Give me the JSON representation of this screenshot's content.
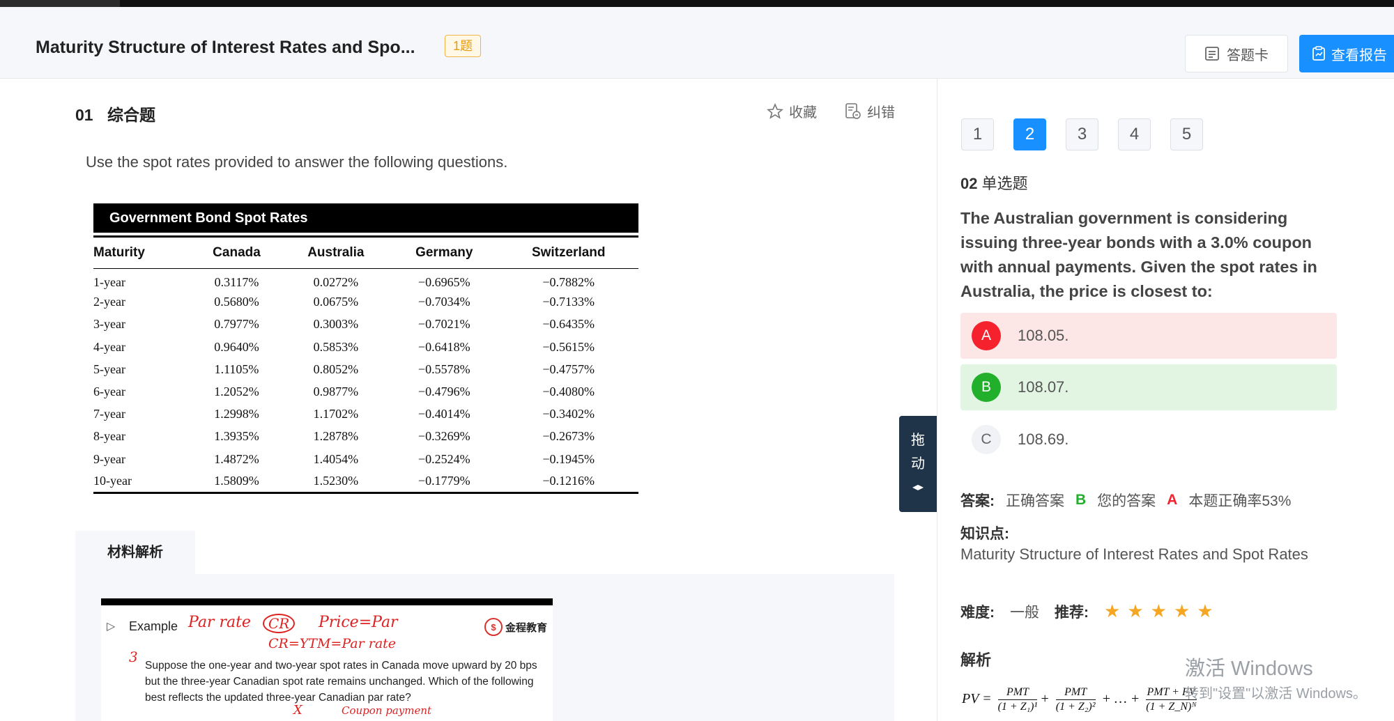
{
  "header": {
    "title": "Maturity Structure of Interest Rates and Spo...",
    "count_badge": "1题",
    "answer_card_label": "答题卡",
    "report_label": "查看报告"
  },
  "question": {
    "number": "01",
    "type": "综合题",
    "favorite_label": "收藏",
    "error_label": "纠错",
    "intro": "Use the spot rates provided to answer the following questions."
  },
  "spot_table": {
    "title": "Government Bond Spot Rates",
    "columns": [
      "Maturity",
      "Canada",
      "Australia",
      "Germany",
      "Switzerland"
    ],
    "rows": [
      [
        "1-year",
        "0.3117%",
        "0.0272%",
        "−0.6965%",
        "−0.7882%"
      ],
      [
        "2-year",
        "0.5680%",
        "0.0675%",
        "−0.7034%",
        "−0.7133%"
      ],
      [
        "3-year",
        "0.7977%",
        "0.3003%",
        "−0.7021%",
        "−0.6435%"
      ],
      [
        "4-year",
        "0.9640%",
        "0.5853%",
        "−0.6418%",
        "−0.5615%"
      ],
      [
        "5-year",
        "1.1105%",
        "0.8052%",
        "−0.5578%",
        "−0.4757%"
      ],
      [
        "6-year",
        "1.2052%",
        "0.9877%",
        "−0.4796%",
        "−0.4080%"
      ],
      [
        "7-year",
        "1.2998%",
        "1.1702%",
        "−0.4014%",
        "−0.3402%"
      ],
      [
        "8-year",
        "1.3935%",
        "1.2878%",
        "−0.3269%",
        "−0.2673%"
      ],
      [
        "9-year",
        "1.4872%",
        "1.4054%",
        "−0.2524%",
        "−0.1945%"
      ],
      [
        "10-year",
        "1.5809%",
        "1.5230%",
        "−0.1779%",
        "−0.1216%"
      ]
    ]
  },
  "material": {
    "tab_label": "材料解析",
    "example_label": "Example",
    "logo_text": "金程教育",
    "example_text": "Suppose the one-year and two-year spot rates in Canada move upward by 20 bps but the three-year Canadian spot rate remains unchanged. Which of the following best reflects the updated three-year Canadian par rate?",
    "handwriting": {
      "a": "Par rate",
      "b": "CR",
      "c": "Price=Par",
      "d": "CR=YTM=Par rate",
      "e": "3",
      "f": "X",
      "g": "Coupon payment"
    }
  },
  "drag_handle": {
    "line1": "拖",
    "line2": "动",
    "line3": "◂▸"
  },
  "pager": {
    "items": [
      "1",
      "2",
      "3",
      "4",
      "5"
    ],
    "active": "2"
  },
  "sub_question": {
    "number": "02",
    "type": "单选题",
    "stem": "The Australian government is considering issuing three-year bonds with a 3.0% coupon with annual payments. Given the spot rates in Australia, the price is closest to:",
    "options": [
      {
        "letter": "A",
        "text": "108.05.",
        "state": "wrong"
      },
      {
        "letter": "B",
        "text": "108.07.",
        "state": "right"
      },
      {
        "letter": "C",
        "text": "108.69.",
        "state": "plain"
      }
    ]
  },
  "answer": {
    "label": "答案:",
    "correct_prefix": "正确答案",
    "correct": "B",
    "yours_prefix": "您的答案",
    "yours": "A",
    "rate": "本题正确率53%"
  },
  "knowledge": {
    "label": "知识点:",
    "text": "Maturity Structure of Interest Rates and Spot Rates"
  },
  "difficulty": {
    "label": "难度:",
    "value": "一般",
    "recommend_label": "推荐:",
    "stars": 5
  },
  "analysis": {
    "label": "解析",
    "formula_pv": "PV =",
    "t1n": "PMT",
    "t1d": "(1 + Z₁)¹",
    "t2n": "PMT",
    "t2d": "(1 + Z₂)²",
    "dots": "+ … +",
    "t3n": "PMT + FV",
    "t3d": "(1 + Z_N)ᴺ"
  },
  "watermark": {
    "line1": "激活 Windows",
    "line2": "转到\"设置\"以激活 Windows。"
  },
  "colors": {
    "primary": "#1890ff",
    "correct": "#22b02c",
    "wrong": "#f5222d",
    "badge": "#e89a10",
    "star": "#f5a623"
  }
}
